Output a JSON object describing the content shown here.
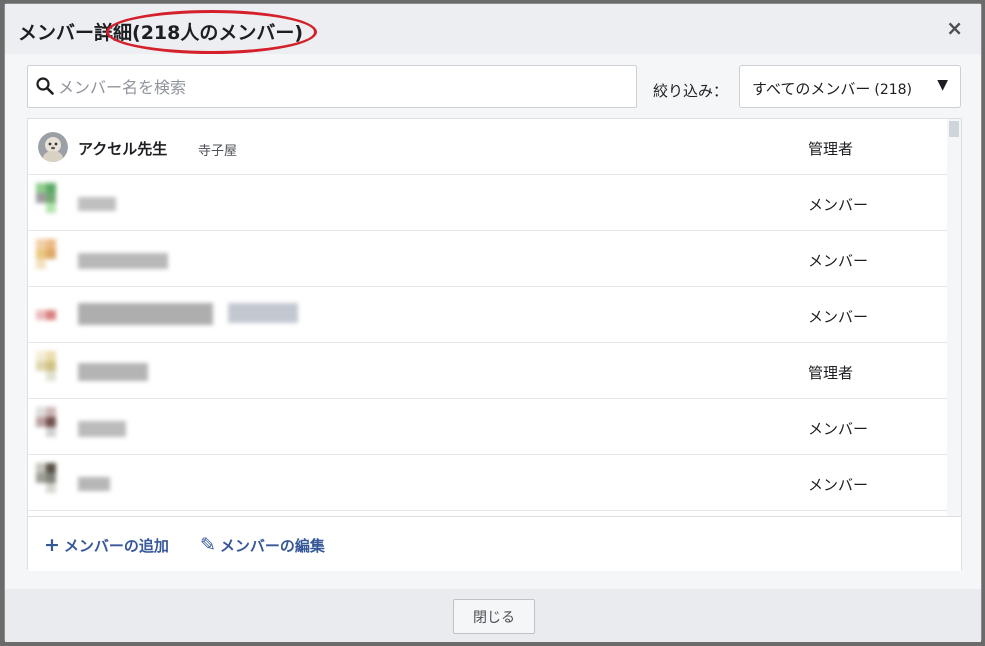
{
  "dialog": {
    "title_prefix": "メンバー詳細",
    "title_count": "(218人のメンバー)",
    "close_icon": "×"
  },
  "search": {
    "placeholder": "メンバー名を検索",
    "icon": "search-icon"
  },
  "filter": {
    "label": "絞り込み：",
    "selected": "すべてのメンバー",
    "count": "(218)",
    "caret": "▼"
  },
  "members": [
    {
      "name": "アクセル先生",
      "sub": "寺子屋",
      "role": "管理者"
    },
    {
      "name": "",
      "sub": "",
      "role": "メンバー"
    },
    {
      "name": "",
      "sub": "",
      "role": "メンバー"
    },
    {
      "name": "",
      "sub": "",
      "role": "メンバー"
    },
    {
      "name": "",
      "sub": "",
      "role": "管理者"
    },
    {
      "name": "",
      "sub": "",
      "role": "メンバー"
    },
    {
      "name": "",
      "sub": "",
      "role": "メンバー"
    }
  ],
  "actions": {
    "add_icon": "+",
    "add_label": "メンバーの追加",
    "edit_icon": "✎",
    "edit_label": "メンバーの編集"
  },
  "footer": {
    "close_label": "閉じる"
  },
  "colors": {
    "highlight_circle": "#d4202a",
    "link": "#365899"
  }
}
